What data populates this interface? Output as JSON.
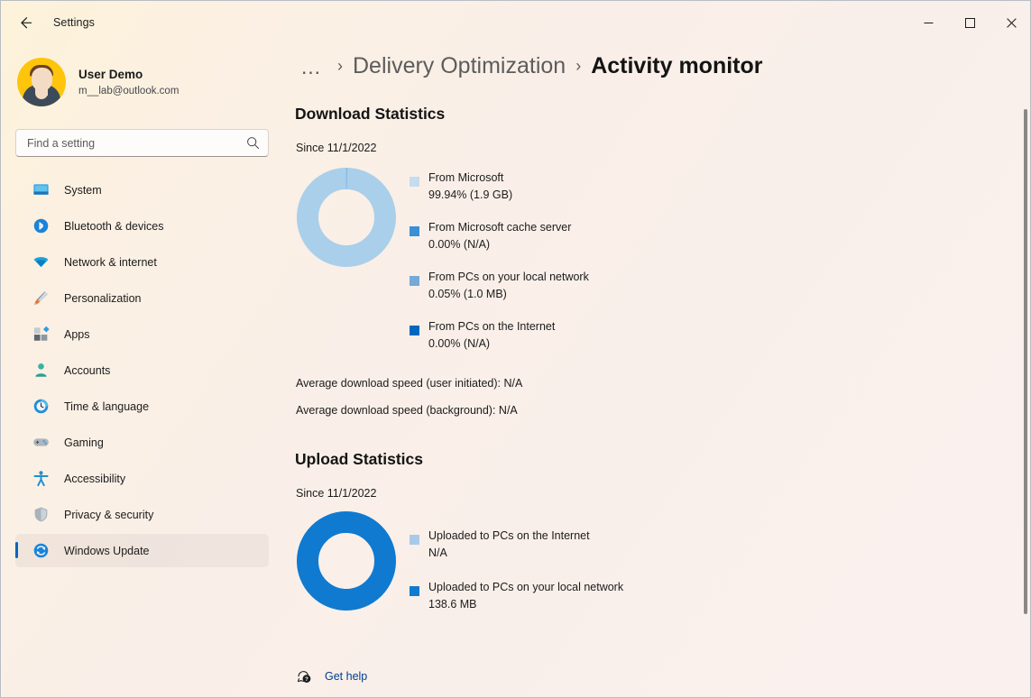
{
  "window": {
    "app_title": "Settings",
    "back_icon": "back-arrow-icon",
    "controls": {
      "minimize": "minimize-icon",
      "maximize": "maximize-icon",
      "close": "close-icon"
    }
  },
  "sidebar": {
    "account": {
      "name": "User Demo",
      "email": "m__lab@outlook.com",
      "avatar_bg": "#ffc40c"
    },
    "search": {
      "placeholder": "Find a setting",
      "value": "",
      "icon": "search-icon"
    },
    "items": [
      {
        "label": "System",
        "icon": "monitor-icon",
        "selected": false
      },
      {
        "label": "Bluetooth & devices",
        "icon": "bluetooth-icon",
        "selected": false
      },
      {
        "label": "Network & internet",
        "icon": "wifi-icon",
        "selected": false
      },
      {
        "label": "Personalization",
        "icon": "paintbrush-icon",
        "selected": false
      },
      {
        "label": "Apps",
        "icon": "apps-grid-icon",
        "selected": false
      },
      {
        "label": "Accounts",
        "icon": "person-icon",
        "selected": false
      },
      {
        "label": "Time & language",
        "icon": "clock-globe-icon",
        "selected": false
      },
      {
        "label": "Gaming",
        "icon": "gamepad-icon",
        "selected": false
      },
      {
        "label": "Accessibility",
        "icon": "accessibility-person-icon",
        "selected": false
      },
      {
        "label": "Privacy & security",
        "icon": "shield-icon",
        "selected": false
      },
      {
        "label": "Windows Update",
        "icon": "update-refresh-icon",
        "selected": true
      }
    ]
  },
  "breadcrumb": {
    "ellipsis": "…",
    "separator": "›",
    "parent": "Delivery Optimization",
    "current": "Activity monitor"
  },
  "download": {
    "title": "Download Statistics",
    "since": "Since 11/1/2022",
    "speeds": [
      "Average download speed (user initiated):   N/A",
      "Average download speed (background):   N/A"
    ]
  },
  "upload": {
    "title": "Upload Statistics",
    "since": "Since 11/1/2022"
  },
  "footer": {
    "help_label": "Get help",
    "help_icon": "help-question-icon"
  },
  "colors": {
    "accent": "#0067c0",
    "link": "#003e92",
    "swatch_light": "#c5dcee",
    "swatch_medium": "#3b8fd4",
    "swatch_mid": "#74a9d8",
    "swatch_dark": "#0067c0",
    "donut_download": "#a9cfeb",
    "donut_upload": "#0f7ad0"
  },
  "chart_data": [
    {
      "type": "pie",
      "title": "Download Statistics",
      "subtitle": "Since 11/1/2022",
      "legend_position": "right",
      "categories": [
        "From Microsoft",
        "From Microsoft cache server",
        "From PCs on your local network",
        "From PCs on the Internet"
      ],
      "values": [
        99.94,
        0.0,
        0.05,
        0.0
      ],
      "value_labels": [
        "99.94%  (1.9 GB)",
        "0.00%  (N/A)",
        "0.05%  (1.0 MB)",
        "0.00%  (N/A)"
      ],
      "amounts": [
        "1.9 GB",
        "N/A",
        "1.0 MB",
        "N/A"
      ],
      "colors": [
        "#c5dcee",
        "#3b8fd4",
        "#74a9d8",
        "#0067c0"
      ],
      "donut": true,
      "unit": "%"
    },
    {
      "type": "pie",
      "title": "Upload Statistics",
      "subtitle": "Since 11/1/2022",
      "legend_position": "right",
      "categories": [
        "Uploaded to PCs on the Internet",
        "Uploaded to PCs on your local network"
      ],
      "values": [
        0,
        100
      ],
      "value_labels": [
        "N/A",
        "138.6 MB"
      ],
      "amounts": [
        "N/A",
        "138.6 MB"
      ],
      "colors": [
        "#a9c9e8",
        "#0f7ad0"
      ],
      "donut": true,
      "unit": "MB"
    }
  ]
}
